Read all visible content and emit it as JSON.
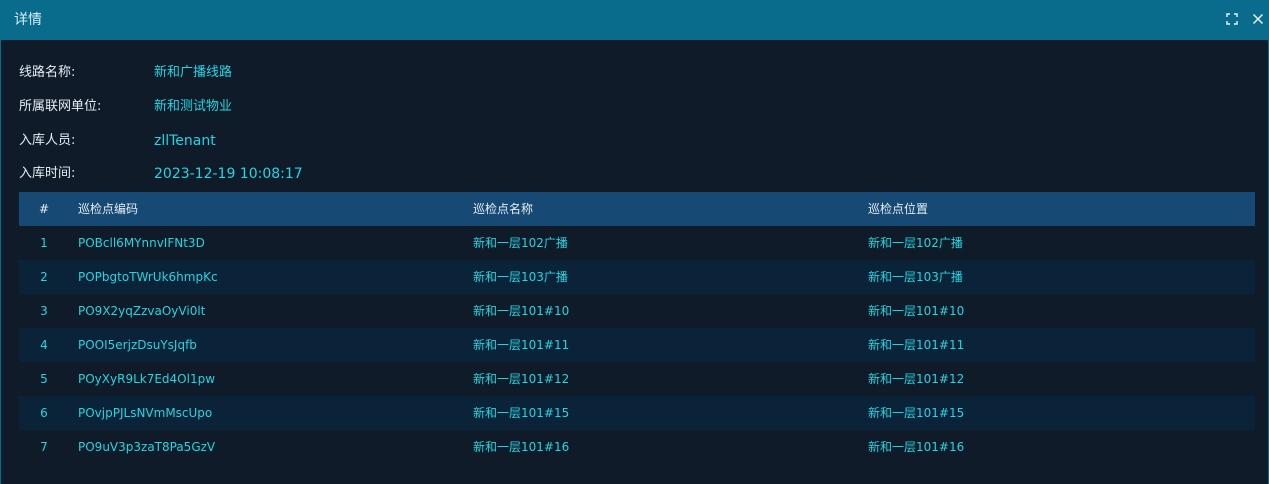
{
  "dialog": {
    "title": "详情",
    "maximize_icon": "fullscreen-icon",
    "close_icon": "close-icon"
  },
  "info": {
    "route_name_label": "线路名称:",
    "route_name_value": "新和广播线路",
    "unit_label": "所属联网单位:",
    "unit_value": "新和测试物业",
    "staff_label": "入库人员:",
    "staff_value": "zllTenant",
    "time_label": "入库时间:",
    "time_value": "2023-12-19 10:08:17"
  },
  "table": {
    "headers": {
      "idx": "#",
      "code": "巡检点编码",
      "name": "巡检点名称",
      "pos": "巡检点位置"
    },
    "rows": [
      {
        "idx": "1",
        "code": "POBcll6MYnnvIFNt3D",
        "name": "新和一层102广播",
        "pos": "新和一层102广播"
      },
      {
        "idx": "2",
        "code": "POPbgtoTWrUk6hmpKc",
        "name": "新和一层103广播",
        "pos": "新和一层103广播"
      },
      {
        "idx": "3",
        "code": "PO9X2yqZzvaOyVi0lt",
        "name": "新和一层101#10",
        "pos": "新和一层101#10"
      },
      {
        "idx": "4",
        "code": "POOI5erjzDsuYsJqfb",
        "name": "新和一层101#11",
        "pos": "新和一层101#11"
      },
      {
        "idx": "5",
        "code": "POyXyR9Lk7Ed4Ol1pw",
        "name": "新和一层101#12",
        "pos": "新和一层101#12"
      },
      {
        "idx": "6",
        "code": "POvjpPJLsNVmMscUpo",
        "name": "新和一层101#15",
        "pos": "新和一层101#15"
      },
      {
        "idx": "7",
        "code": "PO9uV3p3zaT8Pa5GzV",
        "name": "新和一层101#16",
        "pos": "新和一层101#16"
      }
    ]
  },
  "colors": {
    "titlebar": "#0a6c8c",
    "background": "#0f1b29",
    "header_row": "#164a74",
    "stripe_row": "#0b2339",
    "value_text": "#24d5e2",
    "label_text": "#e6edf3"
  }
}
